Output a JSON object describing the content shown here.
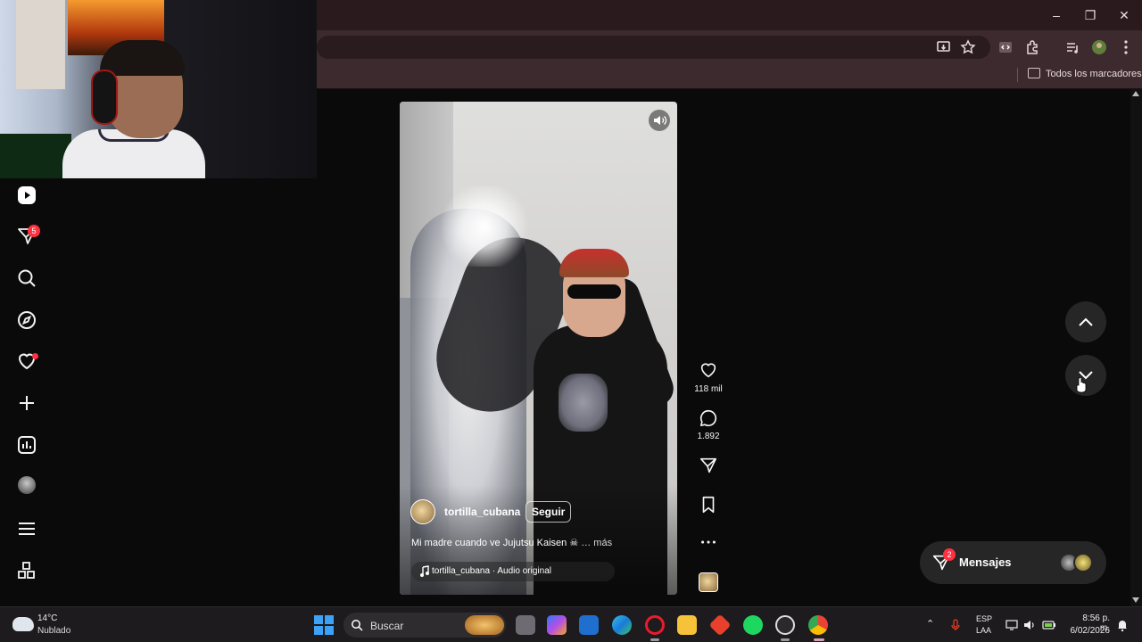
{
  "window": {
    "minimize_glyph": "–",
    "restore_glyph": "❐",
    "close_glyph": "✕"
  },
  "bookmarks": {
    "all_bookmarks_label": "Todos los marcadores"
  },
  "sidebar": {
    "notifications_badge": "5",
    "items": [
      {
        "icon": "reels-logo-icon"
      },
      {
        "icon": "direct-send-icon"
      },
      {
        "icon": "search-icon"
      },
      {
        "icon": "explore-compass-icon"
      },
      {
        "icon": "heart-icon"
      },
      {
        "icon": "create-plus-icon"
      },
      {
        "icon": "dashboard-icon"
      },
      {
        "icon": "profile-avatar"
      },
      {
        "icon": "menu-icon"
      },
      {
        "icon": "more-apps-icon"
      }
    ]
  },
  "reel": {
    "author": "tortilla_cubana",
    "follow_label": "Seguir",
    "caption": "Mi madre cuando ve Jujutsu Kaisen ☠",
    "more_label": "… más",
    "audio": "tortilla_cubana · Audio original",
    "mute_icon": "volume-icon"
  },
  "actions": {
    "likes": "118 mil",
    "comments": "1.892"
  },
  "messages": {
    "label": "Mensajes",
    "badge": "2"
  },
  "taskbar": {
    "temperature": "14°C",
    "condition": "Nublado",
    "search_placeholder": "Buscar",
    "lang_line1": "ESP",
    "lang_line2": "LAA",
    "time": "8:56 p. m.",
    "date": "6/02/2026"
  },
  "colors": {
    "badge_red": "#ff3040",
    "browser_frame": "#3d2a2e",
    "windows_blue": "#3da1f5"
  }
}
